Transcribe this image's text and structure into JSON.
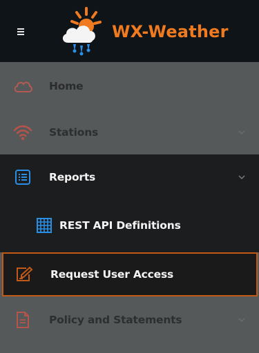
{
  "header": {
    "brand": "WX-Weather",
    "menu_icon": "hamburger-icon",
    "logo_icon": "sun-cloud-rain-icon"
  },
  "nav": {
    "items": [
      {
        "label": "Home",
        "icon": "cloud-icon",
        "state": "dimmed"
      },
      {
        "label": "Stations",
        "icon": "wifi-signal-icon",
        "state": "dimmed",
        "expandable": true
      },
      {
        "label": "Reports",
        "icon": "list-icon",
        "state": "expanded",
        "expandable": true
      },
      {
        "label": "REST API Definitions",
        "icon": "grid-icon",
        "state": "child"
      },
      {
        "label": "Request User Access",
        "icon": "edit-icon",
        "state": "selected"
      },
      {
        "label": "Policy and Statements",
        "icon": "document-icon",
        "state": "dimmed",
        "expandable": true
      }
    ]
  },
  "colors": {
    "accent": "#f07a20",
    "icon_blue": "#2a8fe6",
    "panel_dark": "#1c1d1e",
    "panel_dim": "#56595a"
  }
}
